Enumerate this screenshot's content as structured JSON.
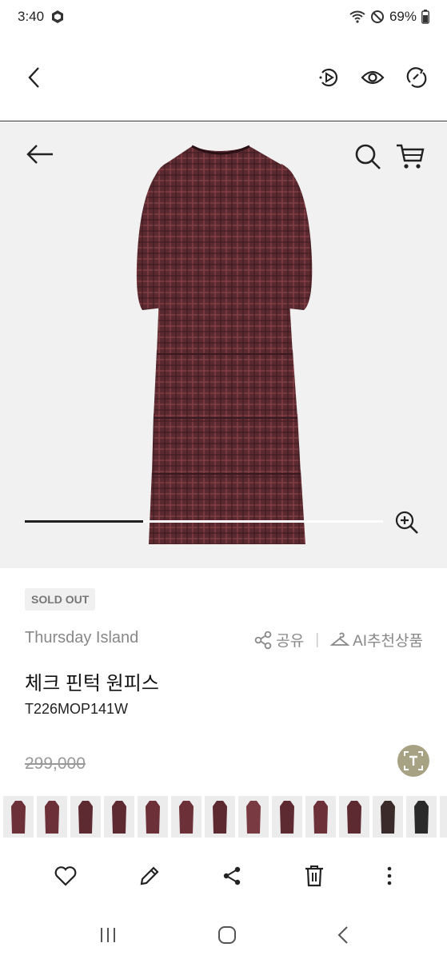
{
  "status": {
    "time": "3:40",
    "battery": "69%"
  },
  "product": {
    "badge": "SOLD OUT",
    "brand": "Thursday Island",
    "share_label": "공유",
    "ai_label": "AI추천상품",
    "name": "체크 핀턱 원피스",
    "code": "T226MOP141W",
    "price": "299,000",
    "carousel_progress": 0.33
  },
  "colors": {
    "dress": "#5a2a30",
    "dress_grid": "#8a4048",
    "ocr_button": "#a8a284",
    "hero_bg": "#f1f1f1"
  },
  "thumbnails": [
    {
      "bg": "#6b3038"
    },
    {
      "bg": "#6b3038"
    },
    {
      "bg": "#5e2a32"
    },
    {
      "bg": "#5e2a32"
    },
    {
      "bg": "#6b3038"
    },
    {
      "bg": "#6b3038"
    },
    {
      "bg": "#5e2a32"
    },
    {
      "bg": "#7a3a42"
    },
    {
      "bg": "#5e2a32"
    },
    {
      "bg": "#6b3038"
    },
    {
      "bg": "#5e2a32"
    },
    {
      "bg": "#3a2a2a"
    },
    {
      "bg": "#2a2a2a"
    },
    {
      "bg": "#2a2a2a"
    }
  ]
}
